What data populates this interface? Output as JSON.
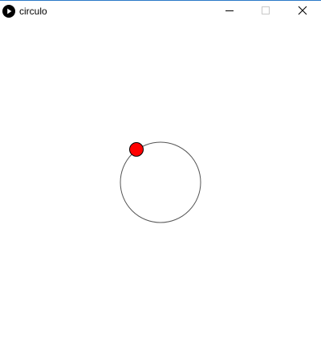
{
  "window": {
    "title": "circulo",
    "app_icon": "play-icon",
    "controls": [
      "minimize-icon",
      "maximize-icon",
      "close-icon"
    ],
    "accent_color": "#2b79c8"
  },
  "sketch": {
    "background_color": "#ffffff",
    "orbit_stroke_color": "#555555",
    "orbit_fill": "none",
    "dot_fill_color": "#ff0000",
    "dot_stroke_color": "#000000"
  }
}
